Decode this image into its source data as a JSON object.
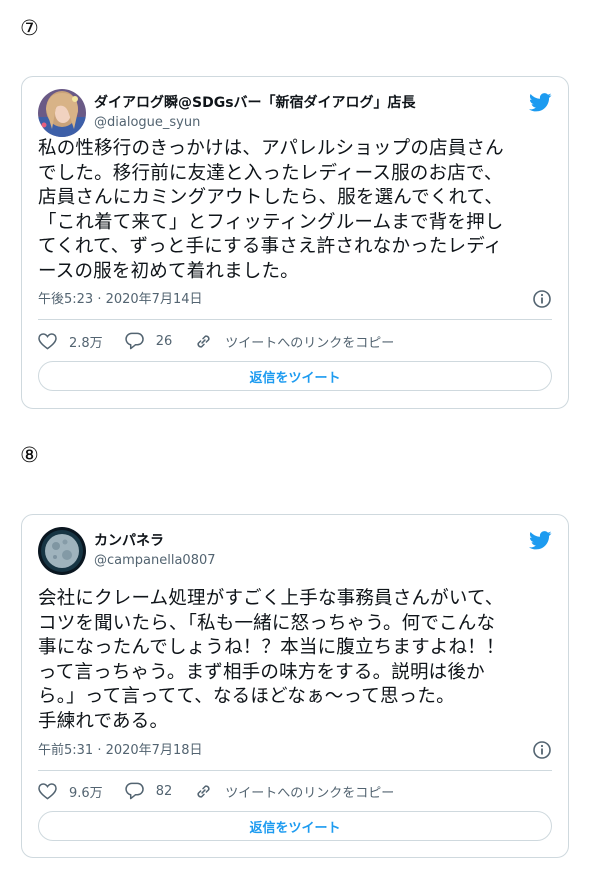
{
  "colors": {
    "accent": "#1d9bf0",
    "muted": "#536471",
    "border": "#cfd9de",
    "text": "#0f1419"
  },
  "sections": [
    {
      "number": "⑦",
      "tweet": {
        "author_name": "ダイアログ瞬@SDGsバー「新宿ダイアログ」店長",
        "author_handle": "@dialogue_syun",
        "avatar_icon": "profile-photo-avatar",
        "platform_icon": "twitter-bird-icon",
        "text": "私の性移行のきっかけは、アパレルショップの店員さん\nでした。移行前に友達と入ったレディース服のお店で、\n店員さんにカミングアウトしたら、服を選んでくれて、\n「これ着て来て」とフィッティングルームまで背を押し\nてくれて、ずっと手にする事さえ許されなかったレディ\nースの服を初めて着れました。",
        "timestamp": "午後5:23 · 2020年7月14日",
        "likes": "2.8万",
        "replies": "26",
        "copy_link_label": "ツイートへのリンクをコピー",
        "reply_button_label": "返信をツイート"
      }
    },
    {
      "number": "⑧",
      "tweet": {
        "author_name": "カンパネラ",
        "author_handle": "@campanella0807",
        "avatar_icon": "moon-avatar",
        "platform_icon": "twitter-bird-icon",
        "text": "会社にクレーム処理がすごく上手な事務員さんがいて、\nコツを聞いたら、「私も一緒に怒っちゃう。何でこんな\n事になったんでしょうね！？本当に腹立ちますよね！！\nって言っちゃう。まず相手の味方をする。説明は後か\nら。」って言ってて、なるほどなぁ～って思った。\n手練れである。",
        "timestamp": "午前5:31 · 2020年7月18日",
        "likes": "9.6万",
        "replies": "82",
        "copy_link_label": "ツイートへのリンクをコピー",
        "reply_button_label": "返信をツイート"
      }
    }
  ]
}
